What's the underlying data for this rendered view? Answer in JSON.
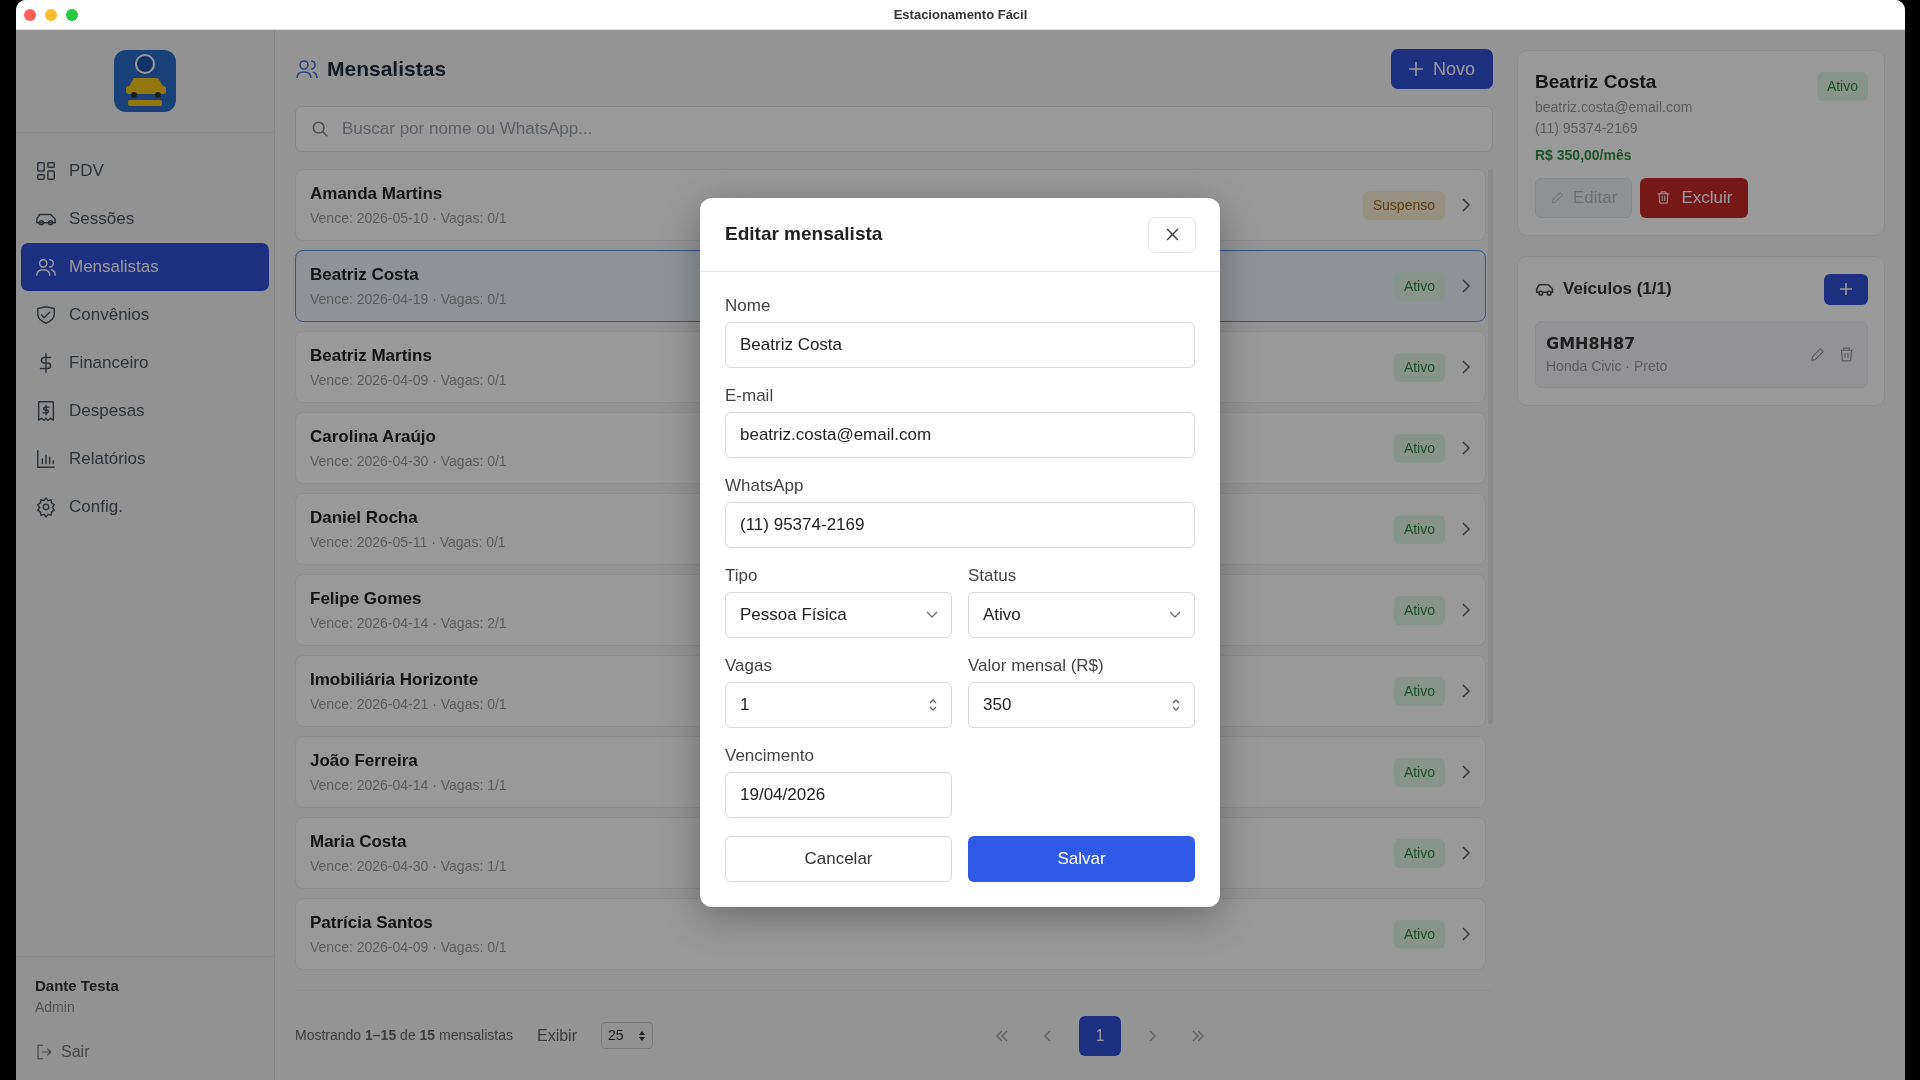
{
  "window": {
    "title": "Estacionamento Fácil"
  },
  "sidebar": {
    "items": [
      {
        "label": "PDV",
        "selected": false
      },
      {
        "label": "Sessões",
        "selected": false
      },
      {
        "label": "Mensalistas",
        "selected": true
      },
      {
        "label": "Convênios",
        "selected": false
      },
      {
        "label": "Financeiro",
        "selected": false
      },
      {
        "label": "Despesas",
        "selected": false
      },
      {
        "label": "Relatórios",
        "selected": false
      },
      {
        "label": "Config.",
        "selected": false
      }
    ],
    "user": {
      "name": "Dante Testa",
      "role": "Admin"
    },
    "logout": "Sair"
  },
  "main": {
    "title": "Mensalistas",
    "new_button": "Novo",
    "search": {
      "placeholder": "Buscar por nome ou WhatsApp..."
    },
    "rows": [
      {
        "name": "Amanda Martins",
        "meta": "Vence: 2026-05-10 · Vagas: 0/1",
        "status": "Suspenso",
        "kind": "warning",
        "selected": false
      },
      {
        "name": "Beatriz Costa",
        "meta": "Vence: 2026-04-19 · Vagas: 0/1",
        "status": "Ativo",
        "kind": "success",
        "selected": true
      },
      {
        "name": "Beatriz Martins",
        "meta": "Vence: 2026-04-09 · Vagas: 0/1",
        "status": "Ativo",
        "kind": "success",
        "selected": false
      },
      {
        "name": "Carolina Araújo",
        "meta": "Vence: 2026-04-30 · Vagas: 0/1",
        "status": "Ativo",
        "kind": "success",
        "selected": false
      },
      {
        "name": "Daniel Rocha",
        "meta": "Vence: 2026-05-11 · Vagas: 0/1",
        "status": "Ativo",
        "kind": "success",
        "selected": false
      },
      {
        "name": "Felipe Gomes",
        "meta": "Vence: 2026-04-14 · Vagas: 2/1",
        "status": "Ativo",
        "kind": "success",
        "selected": false
      },
      {
        "name": "Imobiliária Horizonte",
        "meta": "Vence: 2026-04-21 · Vagas: 0/1",
        "status": "Ativo",
        "kind": "success",
        "selected": false
      },
      {
        "name": "João Ferreira",
        "meta": "Vence: 2026-04-14 · Vagas: 1/1",
        "status": "Ativo",
        "kind": "success",
        "selected": false
      },
      {
        "name": "Maria Costa",
        "meta": "Vence: 2026-04-30 · Vagas: 1/1",
        "status": "Ativo",
        "kind": "success",
        "selected": false
      },
      {
        "name": "Patrícia Santos",
        "meta": "Vence: 2026-04-09 · Vagas: 0/1",
        "status": "Ativo",
        "kind": "success",
        "selected": false
      }
    ],
    "footer": {
      "summary": "Mostrando **1–15** de **15** mensalistas",
      "show_label": "Exibir",
      "page_size": "25",
      "pages": [
        {
          "label": "1",
          "selected": true
        }
      ]
    }
  },
  "detail": {
    "name": "Beatriz Costa",
    "status": "Ativo",
    "email": "beatriz.costa@email.com",
    "phone": "(11) 95374-2169",
    "price": "R$ 350,00/mês",
    "edit_button": "Editar",
    "delete_button": "Excluir",
    "vehicles": {
      "title": "Veículos (1/1)",
      "items": [
        {
          "plate": "GMH8H87",
          "description": "Honda Civic · Preto"
        }
      ]
    }
  },
  "modal": {
    "title": "Editar mensalista",
    "fields": [
      {
        "label": "Nome",
        "value": "Beatriz Costa",
        "kind": "text"
      },
      {
        "label": "E-mail",
        "value": "beatriz.costa@email.com",
        "kind": "text"
      },
      {
        "label": "WhatsApp",
        "value": "(11) 95374-2169",
        "kind": "text"
      },
      {
        "label": "Tipo",
        "value": "Pessoa Física",
        "kind": "select"
      },
      {
        "label": "Status",
        "value": "Ativo",
        "kind": "select"
      },
      {
        "label": "Vagas",
        "value": "1",
        "kind": "number"
      },
      {
        "label": "Valor mensal (R$)",
        "value": "350",
        "kind": "number"
      },
      {
        "label": "Vencimento",
        "value": "19/04/2026",
        "kind": "date"
      }
    ],
    "cancel_button": "Cancelar",
    "save_button": "Salvar"
  }
}
